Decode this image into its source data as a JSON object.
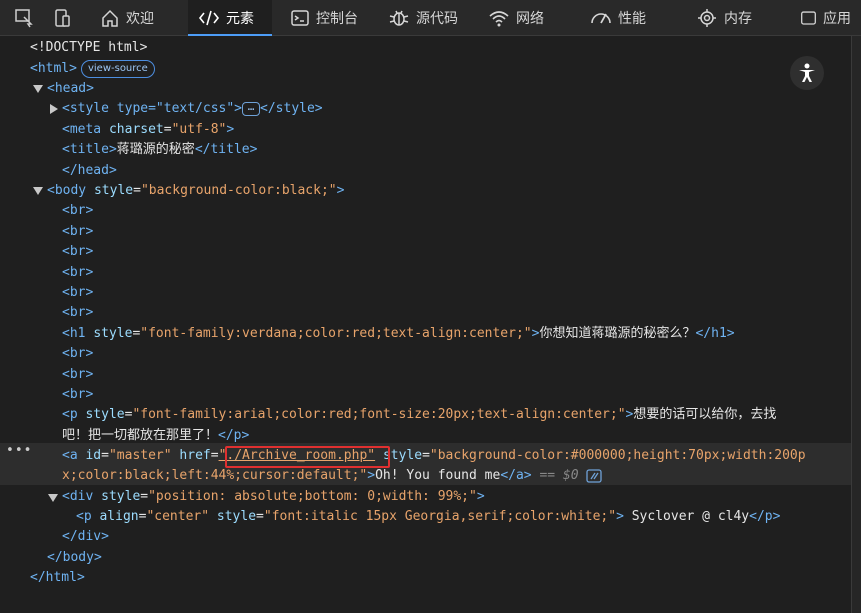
{
  "toolbar": {
    "tabs": [
      {
        "label": "欢迎",
        "icon": "home-icon"
      },
      {
        "label": "元素",
        "icon": "code-tag-icon"
      },
      {
        "label": "控制台",
        "icon": "console-icon"
      },
      {
        "label": "源代码",
        "icon": "bug-icon"
      },
      {
        "label": "网络",
        "icon": "wifi-icon"
      },
      {
        "label": "性能",
        "icon": "gauge-icon"
      },
      {
        "label": "内存",
        "icon": "chip-icon"
      },
      {
        "label": "应用",
        "icon": "app-icon"
      }
    ],
    "active_tab": "元素"
  },
  "dom": {
    "doctype": "<!DOCTYPE html>",
    "html_open": "<html>",
    "view_source": "view-source",
    "head_open": "<head>",
    "style_open": "<style type=\"text/css\">",
    "style_close": "</style>",
    "meta": {
      "tag": "<meta ",
      "attr": "charset",
      "val": "\"utf-8\"",
      "close": ">"
    },
    "title": {
      "open": "<title>",
      "text": "蒋璐源的秘密",
      "close": "</title>"
    },
    "head_close": "</head>",
    "body_open": {
      "tag": "<body ",
      "attr": "style",
      "val": "\"background-color:black;\"",
      "close": ">"
    },
    "br": "<br>",
    "h1": {
      "tag": "<h1 ",
      "attr": "style",
      "val": "\"font-family:verdana;color:red;text-align:center;\"",
      "mid": ">",
      "text": "你想知道蒋璐源的秘密么？",
      "close": "</h1>"
    },
    "p": {
      "tag": "<p ",
      "attr": "style",
      "val": "\"font-family:arial;color:red;font-size:20px;text-align:center;\"",
      "mid": ">",
      "text1": "想要的话可以给你，去找",
      "text2": "吧！把一切都放在那里了！",
      "close": "</p>"
    },
    "a": {
      "tag": "<a ",
      "id_attr": "id",
      "id_val": "\"master\"",
      "href_attr": "href",
      "href_val": "\"./Archive_room.php\"",
      "style_attr": "style",
      "style_val1": "\"background-color:#000000;height:70px;width:200p",
      "style_val2": "x;color:black;left:44%;cursor:default;\"",
      "mid": ">",
      "text": "Oh! You found me",
      "close": "</a>",
      "dollar": "== $0"
    },
    "div": {
      "tag": "<div ",
      "attr": "style",
      "val": "\"position: absolute;bottom: 0;width: 99%;\"",
      "close": ">"
    },
    "p2": {
      "tag": "<p ",
      "attr1": "align",
      "val1": "\"center\"",
      "attr2": "style",
      "val2": "\"font:italic 15px Georgia,serif;color:white;\"",
      "mid": ">",
      "text": " Syclover @ cl4y",
      "close": "</p>"
    },
    "div_close": "</div>",
    "body_close": "</body>",
    "html_close": "</html>",
    "row_menu": "•••"
  }
}
